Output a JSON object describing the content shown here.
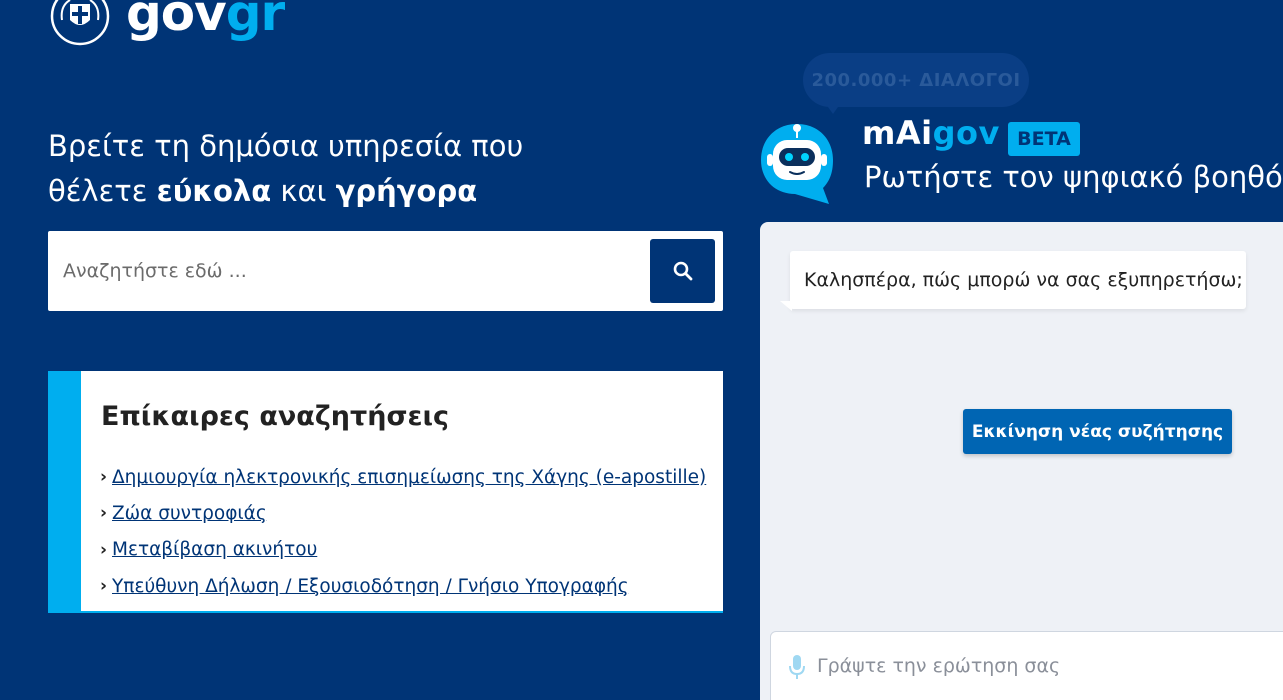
{
  "brand": {
    "wordmark_gov": "gov",
    "wordmark_gr": "gr",
    "primary_color": "#003476",
    "accent_color": "#00aeef"
  },
  "hero": {
    "line1": "Βρείτε τη δημόσια υπηρεσία που",
    "line2_prefix": "θέλετε ",
    "line2_bold1": "εύκολα",
    "line2_mid": " και ",
    "line2_bold2": "γρήγορα"
  },
  "search": {
    "placeholder": "Αναζητήστε εδώ ...",
    "value": "",
    "button_icon": "search-icon"
  },
  "trending": {
    "title": "Επίκαιρες αναζητήσεις",
    "items": [
      {
        "label": "Δημιουργία ηλεκτρονικής επισημείωσης της Χάγης (e-apostille)"
      },
      {
        "label": "Ζώα συντροφιάς"
      },
      {
        "label": "Μεταβίβαση ακινήτου"
      },
      {
        "label": "Υπεύθυνη Δήλωση / Εξουσιοδότηση / Γνήσιο Υπογραφής"
      }
    ]
  },
  "chatbot": {
    "badge": "200.000+ ΔΙΑΛΟΓΟΙ",
    "name_prefix": "mAi",
    "name_suffix": "gov",
    "beta": "BETA",
    "subtitle": "Ρωτήστε τον ψηφιακό βοηθό",
    "greeting": "Καλησπέρα, πώς μπορώ να σας εξυπηρετήσω;",
    "new_chat_label": "Εκκίνηση νέας συζήτησης",
    "input_placeholder": "Γράψτε την ερώτηση σας",
    "input_value": ""
  }
}
